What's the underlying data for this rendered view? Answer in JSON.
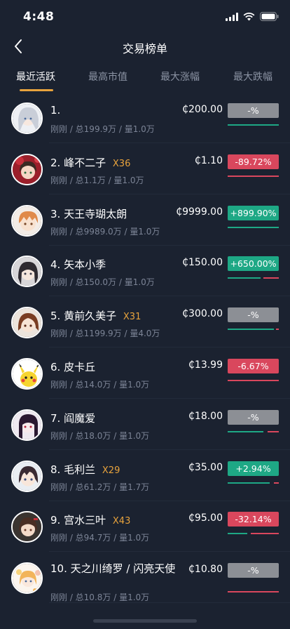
{
  "status": {
    "time": "4:48"
  },
  "nav": {
    "title": "交易榜单"
  },
  "tabs": [
    {
      "label": "最近活跃",
      "active": true
    },
    {
      "label": "最高市值",
      "active": false
    },
    {
      "label": "最大涨幅",
      "active": false
    },
    {
      "label": "最大跌幅",
      "active": false
    }
  ],
  "colors": {
    "accent": "#e8a33d",
    "up": "#1ea885",
    "down": "#d9475d",
    "neutral": "#8c8f95",
    "background": "#1b2230"
  },
  "rows": [
    {
      "rank": "1.",
      "name": "",
      "mult": "",
      "sub": "刚刚 / 总199.9万 / 量1.0万",
      "price": "₵200.00",
      "change": "-%",
      "tone": "grey",
      "green": 1.0,
      "red": 0.0,
      "avatar": "white-haired-girl"
    },
    {
      "rank": "2.",
      "name": "峰不二子",
      "mult": "X36",
      "sub": "刚刚 / 总1.1万 / 量1.0万",
      "price": "₵1.10",
      "change": "-89.72%",
      "tone": "red",
      "green": 0.0,
      "red": 1.0,
      "avatar": "red-haired-girl"
    },
    {
      "rank": "3.",
      "name": "天王寺瑚太朗",
      "mult": "",
      "sub": "刚刚 / 总9989.0万 / 量1.0万",
      "price": "₵9999.00",
      "change": "+899.90%",
      "tone": "green",
      "green": 1.0,
      "red": 0.0,
      "avatar": "orange-haired-boy"
    },
    {
      "rank": "4.",
      "name": "矢本小季",
      "mult": "",
      "sub": "刚刚 / 总150.0万 / 量1.0万",
      "price": "₵150.00",
      "change": "+650.00%",
      "tone": "green",
      "green": 0.65,
      "red": 0.3,
      "avatar": "dark-haired-girl"
    },
    {
      "rank": "5.",
      "name": "黄前久美子",
      "mult": "X31",
      "sub": "刚刚 / 总1199.9万 / 量4.0万",
      "price": "₵300.00",
      "change": "-%",
      "tone": "grey",
      "green": 0.9,
      "red": 0.05,
      "avatar": "brown-haired-girl"
    },
    {
      "rank": "6.",
      "name": "皮卡丘",
      "mult": "",
      "sub": "刚刚 / 总14.0万 / 量1.0万",
      "price": "₵13.99",
      "change": "-6.67%",
      "tone": "red",
      "green": 0.0,
      "red": 1.0,
      "avatar": "pikachu"
    },
    {
      "rank": "7.",
      "name": "阎魔爱",
      "mult": "",
      "sub": "刚刚 / 总18.0万 / 量1.0万",
      "price": "₵18.00",
      "change": "-%",
      "tone": "grey",
      "green": 0.7,
      "red": 0.22,
      "avatar": "purple-haired-girl"
    },
    {
      "rank": "8.",
      "name": "毛利兰",
      "mult": "X29",
      "sub": "刚刚 / 总61.2万 / 量1.7万",
      "price": "₵35.00",
      "change": "+2.94%",
      "tone": "green",
      "green": 0.82,
      "red": 0.1,
      "avatar": "ran-mouri"
    },
    {
      "rank": "9.",
      "name": "宫水三叶",
      "mult": "X43",
      "sub": "刚刚 / 总94.7万 / 量1.0万",
      "price": "₵95.00",
      "change": "-32.14%",
      "tone": "red",
      "green": 0.38,
      "red": 0.55,
      "avatar": "mitsuha"
    },
    {
      "rank": "10.",
      "name": "天之川绮罗 / 闪亮天使",
      "mult": "",
      "sub": "刚刚 / 总10.8万 / 量1.0万",
      "price": "₵10.80",
      "change": "-%",
      "tone": "grey",
      "green": 0.0,
      "red": 1.0,
      "avatar": "angel"
    }
  ]
}
